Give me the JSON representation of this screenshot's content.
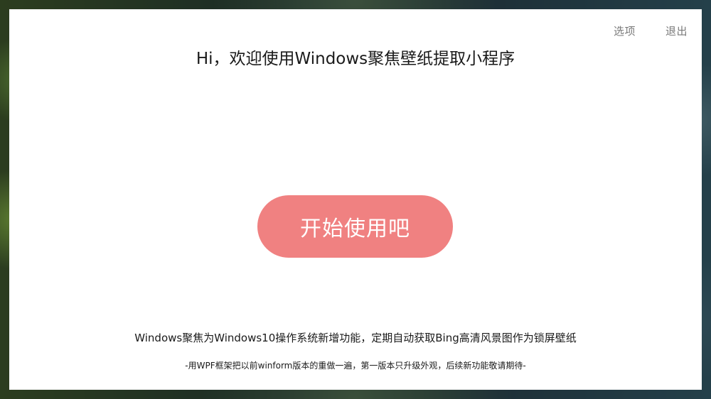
{
  "header": {
    "options_label": "选项",
    "exit_label": "退出"
  },
  "main": {
    "title": "Hi，欢迎使用Windows聚焦壁纸提取小程序",
    "start_button_label": "开始使用吧",
    "description": "Windows聚焦为Windows10操作系统新增功能，定期自动获取Bing高清风景图作为锁屏壁纸",
    "note": "-用WPF框架把以前winform版本的重做一遍，第一版本只升级外观，后续新功能敬请期待-"
  },
  "colors": {
    "button_bg": "#f08181",
    "window_bg": "#ffffff",
    "link_text": "#7a7a7a"
  }
}
